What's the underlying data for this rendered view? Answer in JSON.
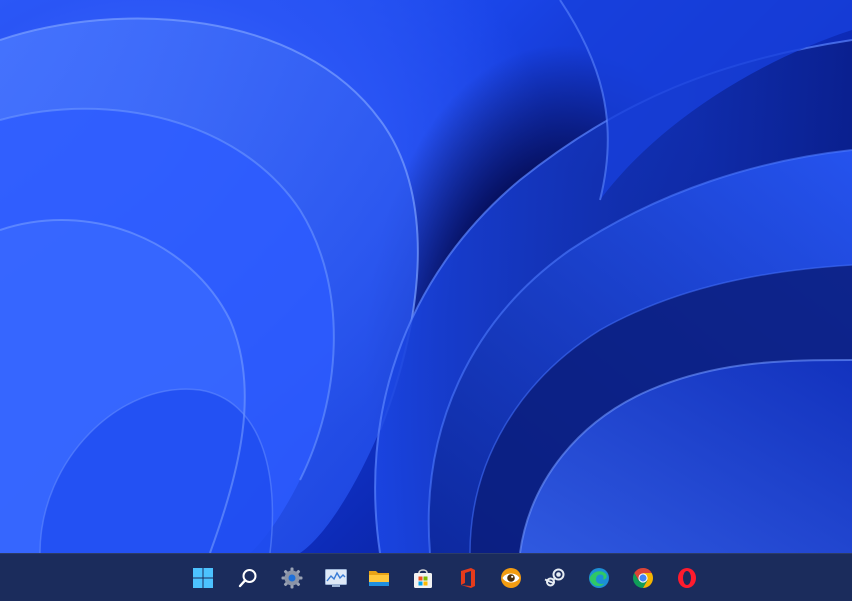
{
  "taskbar": {
    "items": [
      {
        "id": "start",
        "icon": "windows-logo-icon"
      },
      {
        "id": "search",
        "icon": "search-icon"
      },
      {
        "id": "settings",
        "icon": "gear-icon"
      },
      {
        "id": "task-manager",
        "icon": "monitor-graph-icon"
      },
      {
        "id": "file-explorer",
        "icon": "folder-icon"
      },
      {
        "id": "microsoft-store",
        "icon": "store-bag-icon"
      },
      {
        "id": "office",
        "icon": "office-icon"
      },
      {
        "id": "eye-app",
        "icon": "eye-icon"
      },
      {
        "id": "steam",
        "icon": "steam-icon"
      },
      {
        "id": "edge",
        "icon": "edge-icon"
      },
      {
        "id": "chrome",
        "icon": "chrome-icon"
      },
      {
        "id": "opera",
        "icon": "opera-icon"
      }
    ]
  },
  "colors": {
    "taskbar": "#1b2c5c",
    "wallpaper_light": "#3f6dff",
    "wallpaper_dark": "#050b3a"
  }
}
